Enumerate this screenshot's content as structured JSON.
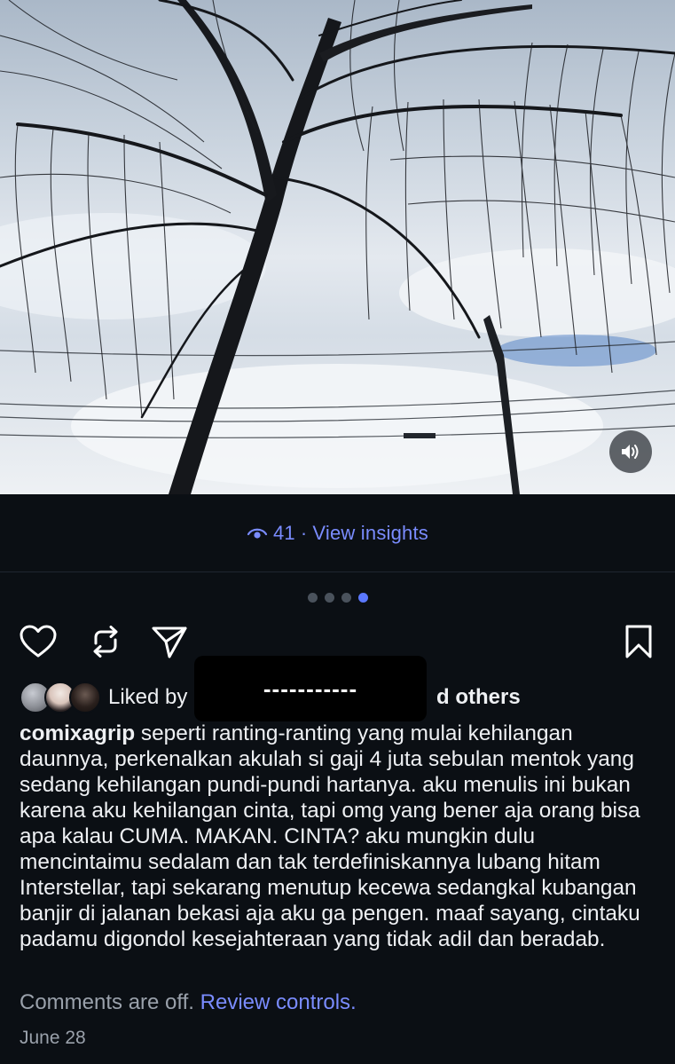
{
  "post": {
    "views": "41",
    "view_insights": "View insights",
    "carousel": {
      "total": 4,
      "active": 4
    },
    "sound_icon": "speaker-icon"
  },
  "likes": {
    "prefix": "Liked by",
    "redacted": "-----------",
    "suffix": "d others"
  },
  "caption": {
    "username": "comixagrip",
    "text": "seperti ranting-ranting yang mulai kehilangan daunnya, perkenalkan akulah si gaji 4 juta sebulan mentok yang sedang kehilangan pundi-pundi hartanya. aku menulis ini bukan karena aku kehilangan cinta, tapi omg yang bener aja orang bisa apa kalau CUMA. MAKAN. CINTA? aku mungkin dulu mencintaimu sedalam dan tak terdefiniskannya lubang hitam Interstellar, tapi sekarang menutup kecewa sedangkal kubangan banjir di jalanan bekasi aja aku ga pengen. maaf sayang, cintaku padamu digondol kesejahteraan yang tidak adil dan beradab."
  },
  "comments": {
    "off_text": "Comments are off.",
    "review_link": "Review controls."
  },
  "date": "June 28",
  "colors": {
    "background": "#0b0f14",
    "link": "#7a8cff",
    "muted": "#9aa1ab",
    "active_dot": "#5b78ff"
  }
}
